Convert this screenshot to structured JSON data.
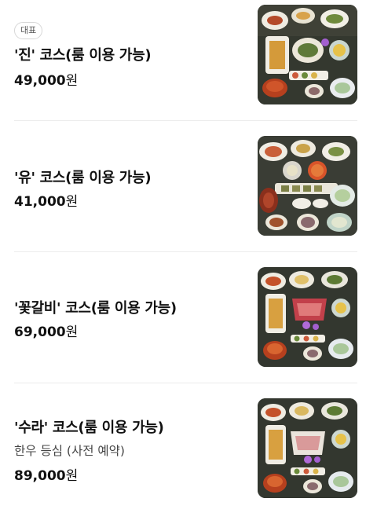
{
  "menu": {
    "items": [
      {
        "badge": "대표",
        "name": "'진' 코스(룸 이용 가능)",
        "description": "",
        "price_value": "49,000",
        "price_unit": "원",
        "photo": "korean-course-meal-photo"
      },
      {
        "badge": "",
        "name": "'유' 코스(룸 이용 가능)",
        "description": "",
        "price_value": "41,000",
        "price_unit": "원",
        "photo": "korean-course-meal-photo"
      },
      {
        "badge": "",
        "name": "'꽃갈비' 코스(룸 이용 가능)",
        "description": "",
        "price_value": "69,000",
        "price_unit": "원",
        "photo": "korean-course-meal-photo"
      },
      {
        "badge": "",
        "name": "'수라' 코스(룸 이용 가능)",
        "description": "한우 등심 (사전 예약)",
        "price_value": "89,000",
        "price_unit": "원",
        "photo": "korean-course-meal-photo"
      }
    ]
  },
  "colors": {
    "text": "#111111",
    "subtext": "#444444",
    "divider": "#ececec",
    "badge_border": "#d7d7d7"
  }
}
